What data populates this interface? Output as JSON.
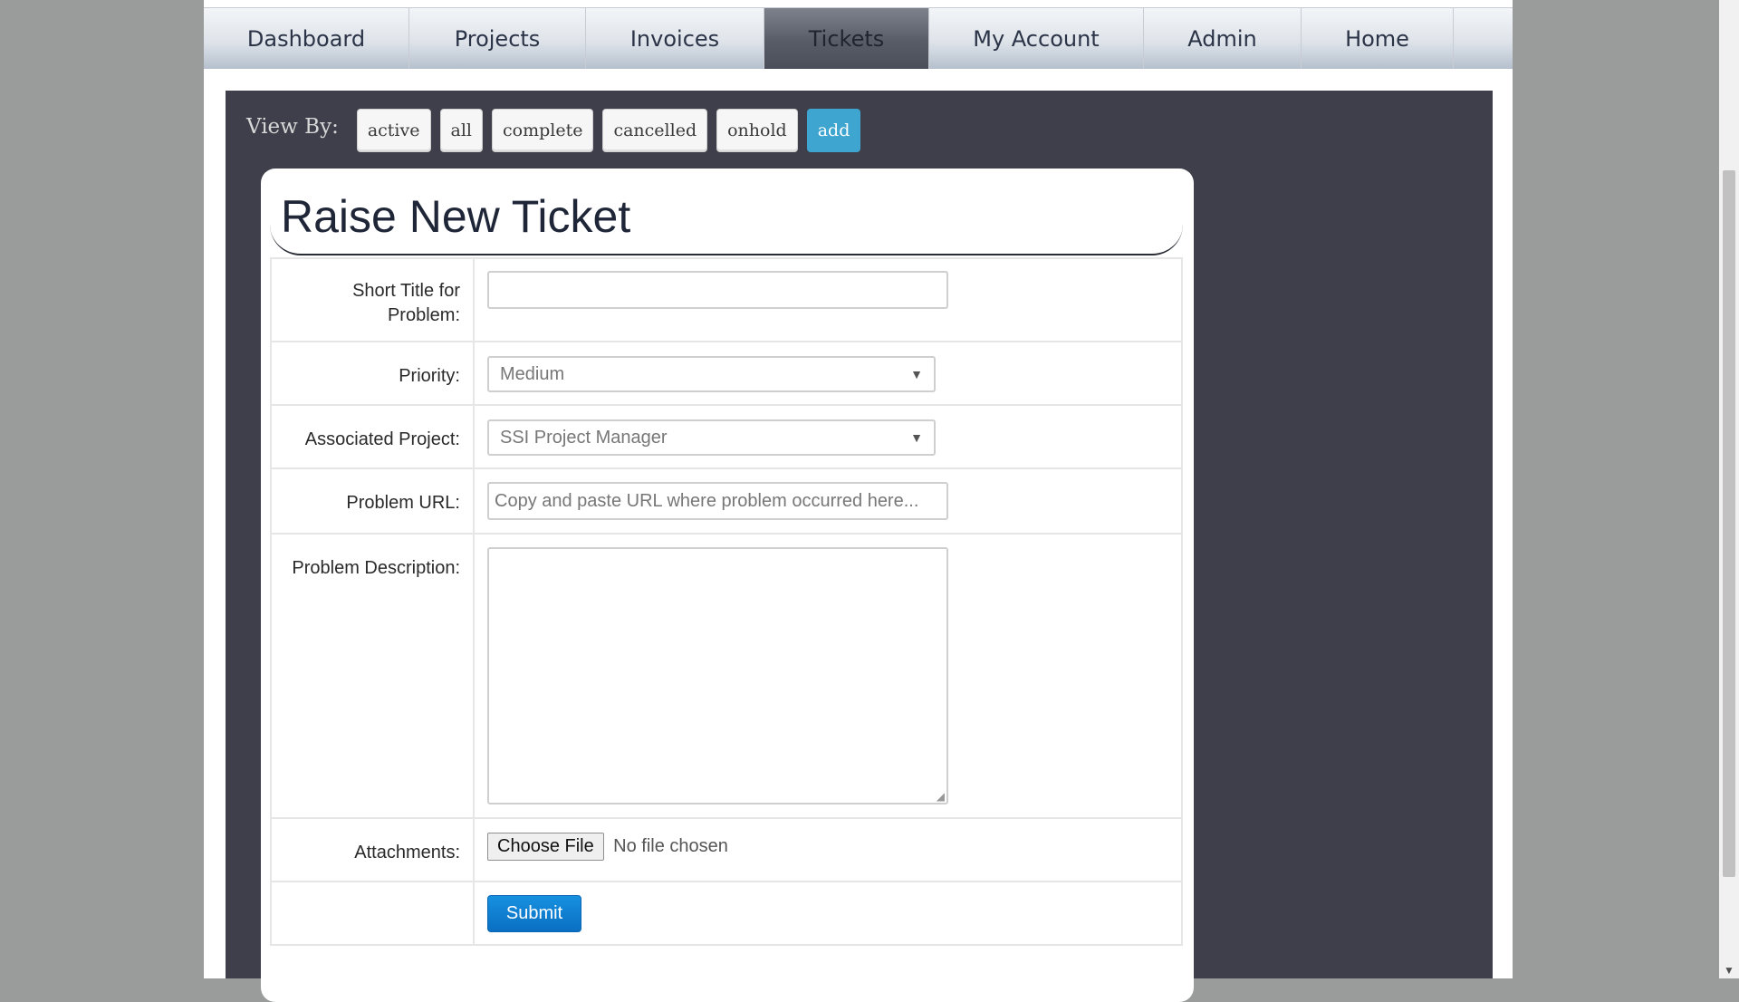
{
  "nav": {
    "items": [
      {
        "label": "Dashboard"
      },
      {
        "label": "Projects"
      },
      {
        "label": "Invoices"
      },
      {
        "label": "Tickets",
        "active": true
      },
      {
        "label": "My Account"
      },
      {
        "label": "Admin"
      },
      {
        "label": "Home"
      }
    ]
  },
  "viewby": {
    "label": "View By:",
    "buttons": [
      "active",
      "all",
      "complete",
      "cancelled",
      "onhold",
      "add"
    ]
  },
  "form": {
    "title": "Raise New Ticket",
    "short_title_label": "Short Title for Problem:",
    "short_title_value": "",
    "priority_label": "Priority:",
    "priority_value": "Medium",
    "project_label": "Associated Project:",
    "project_value": "SSI Project Manager",
    "url_label": "Problem URL:",
    "url_placeholder": "Copy and paste URL where problem occurred here...",
    "description_label": "Problem Description:",
    "attachments_label": "Attachments:",
    "choose_file_label": "Choose File",
    "no_file_text": "No file chosen",
    "submit_label": "Submit"
  },
  "colors": {
    "panel": "#3e3f4a",
    "accent": "#3ea4d0",
    "submit": "#0a6fc2"
  }
}
